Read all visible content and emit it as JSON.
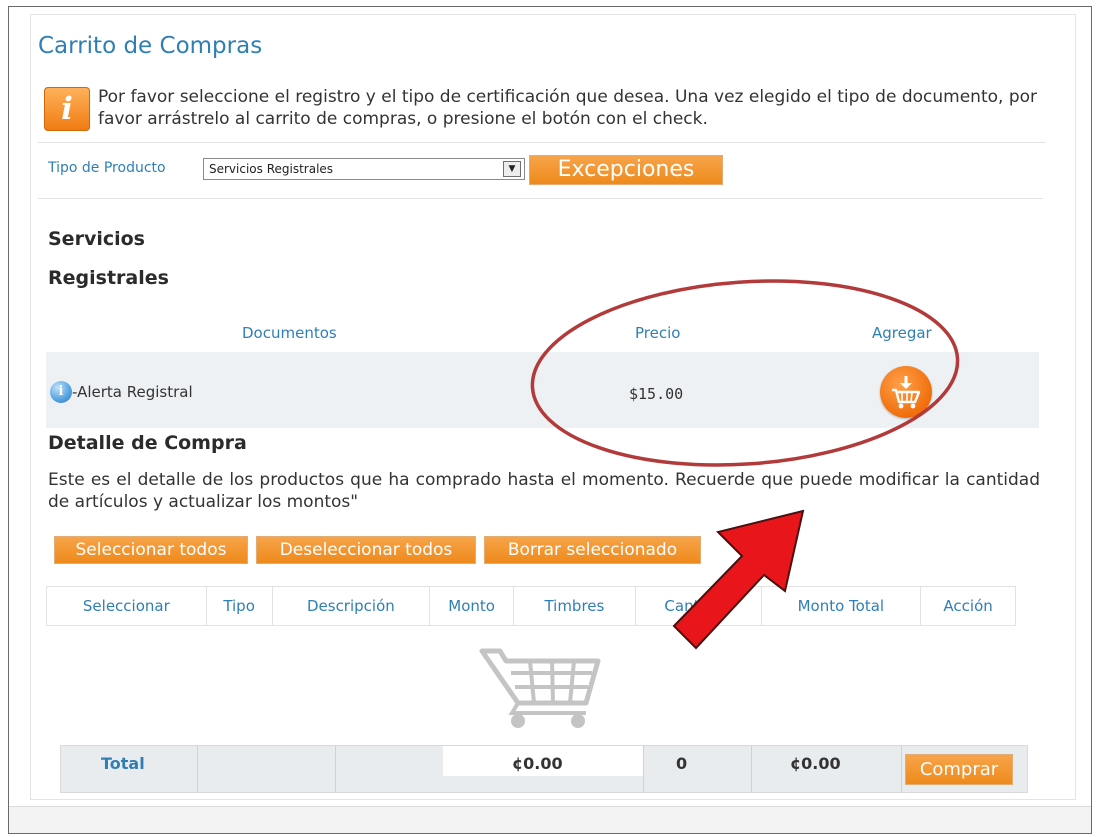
{
  "page": {
    "title": "Carrito de Compras"
  },
  "info": {
    "icon": "info-icon",
    "glyph": "i",
    "message": "Por favor seleccione el registro y el tipo de certificación que desea. Una vez elegido el tipo de documento, por favor arrástrelo al carrito de compras, o presione el botón con el check."
  },
  "filter": {
    "label": "Tipo de Producto",
    "selected": "Servicios Registrales",
    "exceptions_button": "Excepciones"
  },
  "section": {
    "title_line1": "Servicios",
    "title_line2": "Registrales"
  },
  "products": {
    "headers": {
      "documents": "Documentos",
      "price": "Precio",
      "add": "Agregar"
    },
    "row": {
      "name": "-Alerta Registral",
      "price": "$15.00",
      "info_icon": "info-circle-icon",
      "add_icon": "add-to-cart-icon"
    }
  },
  "detail": {
    "title": "Detalle de Compra",
    "description": "Este es el detalle de los productos que ha comprado hasta el momento. Recuerde que puede modificar la cantidad de artículos y actualizar los montos\"",
    "buttons": {
      "select_all": "Seleccionar todos",
      "deselect_all": "Deseleccionar todos",
      "delete_selected": "Borrar seleccionado"
    },
    "columns": [
      "Seleccionar",
      "Tipo",
      "Descripción",
      "Monto",
      "Timbres",
      "Cantidad",
      "Monto Total",
      "Acción"
    ],
    "empty_icon": "empty-cart-icon"
  },
  "totals": {
    "label": "Total",
    "amount": "¢0.00",
    "quantity": "0",
    "total_amount": "¢0.00",
    "buy_button": "Comprar"
  },
  "annotation": {
    "highlight_color": "#b23a3a",
    "arrow_color": "#e8161a"
  },
  "colors": {
    "accent_blue": "#2f7fb5",
    "orange": "#ef8d22"
  }
}
